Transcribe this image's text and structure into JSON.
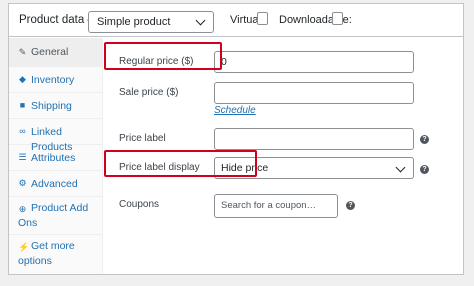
{
  "header": {
    "title": "Product data —",
    "product_type": "Simple product",
    "virtual_label": "Virtual:",
    "downloadable_label": "Downloadable:"
  },
  "sidebar": {
    "items": [
      {
        "label": "General",
        "icon": "wrench-icon",
        "active": true
      },
      {
        "label": "Inventory",
        "icon": "tag-icon"
      },
      {
        "label": "Shipping",
        "icon": "truck-icon"
      },
      {
        "label": "Linked Products",
        "icon": "link-icon"
      },
      {
        "label": "Attributes",
        "icon": "list-icon"
      },
      {
        "label": "Advanced",
        "icon": "gear-icon"
      },
      {
        "label": "Product Add Ons",
        "icon": "plus-circle-icon"
      },
      {
        "label": "Get more options",
        "icon": "plug-icon"
      }
    ]
  },
  "fields": {
    "regular_price_label": "Regular price ($)",
    "regular_price_value": "0",
    "sale_price_label": "Sale price ($)",
    "sale_price_value": "",
    "schedule_link": "Schedule",
    "price_label_label": "Price label",
    "price_label_value": "",
    "price_label_display_label": "Price label display",
    "price_label_display_value": "Hide price",
    "coupons_label": "Coupons",
    "coupons_placeholder": "Search for a coupon…"
  },
  "help_glyph": "?",
  "colors": {
    "highlight": "#d0021b",
    "link": "#2271b1",
    "active_tab_bg": "#eeeeee"
  }
}
